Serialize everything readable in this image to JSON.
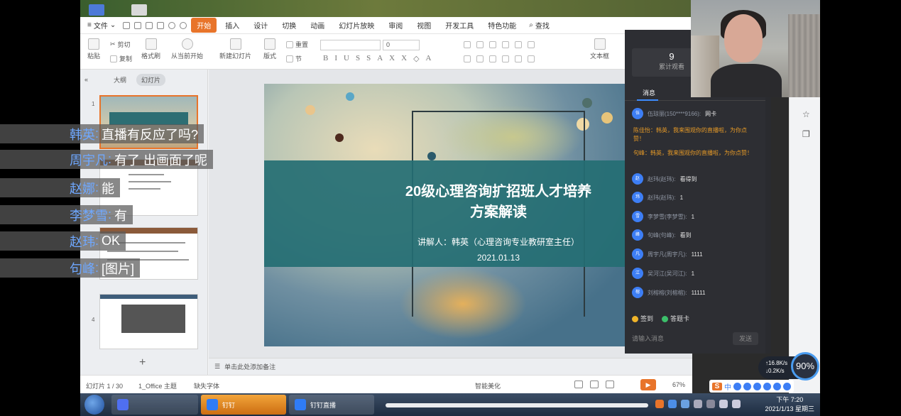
{
  "menubar": {
    "file": "文件",
    "tabs": [
      "开始",
      "插入",
      "设计",
      "切换",
      "动画",
      "幻灯片放映",
      "审阅",
      "视图",
      "开发工具",
      "特色功能"
    ],
    "search": "查找"
  },
  "ribbon": {
    "paste": "粘贴",
    "cut": "剪切",
    "copy": "复制",
    "format_painter": "格式刷",
    "from_current": "从当前开始",
    "new_slide": "新建幻灯片",
    "layout": "版式",
    "reset": "重置",
    "section": "节",
    "font_size": "0",
    "textbox": "文本框"
  },
  "left_pane": {
    "outline_tab": "大纲",
    "slides_tab": "幻灯片",
    "thumb_numbers": [
      "1",
      "4"
    ],
    "add": "+"
  },
  "slide": {
    "title_line1": "20级心理咨询扩招班人才培养",
    "title_line2": "方案解读",
    "presenter": "讲解人：韩英（心理咨询专业教研室主任）",
    "date": "2021.01.13"
  },
  "notes_placeholder": "单击此处添加备注",
  "statusbar": {
    "slide_count": "幻灯片 1 / 30",
    "theme": "1_Office 主题",
    "missing_font": "缺失字体",
    "beautify": "智能美化",
    "zoom": "67%"
  },
  "live_panel": {
    "viewer_count": "9",
    "viewer_label": "累计观看",
    "tab_messages": "消息",
    "messages": [
      {
        "avatar": "伍",
        "name": "伍琼丽(150****9166):",
        "text": "网卡"
      },
      {
        "avatar": "赵",
        "name": "赵玮(赵玮):",
        "text": "看得到"
      },
      {
        "avatar": "玮",
        "name": "赵玮(赵玮):",
        "text": "1"
      },
      {
        "avatar": "雪",
        "name": "李梦雪(李梦雪):",
        "text": "1"
      },
      {
        "avatar": "峰",
        "name": "句峰(句峰):",
        "text": "看到"
      },
      {
        "avatar": "凡",
        "name": "周宇凡(周宇凡):",
        "text": "1111"
      },
      {
        "avatar": "江",
        "name": "吴河江(吴河江):",
        "text": "1"
      },
      {
        "avatar": "榕",
        "name": "刘榕榕(刘榕榕):",
        "text": "11111"
      }
    ],
    "system_messages": [
      "陈佳怡：韩英，我来围观你的直播啦，为你点赞！",
      "句峰：韩英，我来围观你的直播啦，为你点赞！"
    ],
    "action_signin": "签到",
    "action_card": "答题卡",
    "input_placeholder": "请输入消息",
    "send": "发送"
  },
  "chat_overlay": [
    {
      "who": "韩英",
      "said": "直播有反应了吗?"
    },
    {
      "who": "周宇凡",
      "said": "有了  出画面了呢"
    },
    {
      "who": "赵娜",
      "said": "能"
    },
    {
      "who": "李梦雪",
      "said": "有"
    },
    {
      "who": "赵玮",
      "said": "OK"
    },
    {
      "who": "句峰",
      "said": "[图片]"
    }
  ],
  "net_speed": {
    "up": "↑16.8K/s",
    "down": "↓0.2K/s",
    "percent": "90%"
  },
  "ime": {
    "brand": "S",
    "lang": "中"
  },
  "taskbar": {
    "btn1": "钉钉",
    "btn2": "钉钉直播",
    "time": "下午 7:20",
    "date": "2021/1/13 星期三"
  },
  "colors": {
    "accent": "#e8742a",
    "teal_band": "#246e73",
    "panel": "#2d2e33",
    "chat_name": "#6fa8ff"
  }
}
